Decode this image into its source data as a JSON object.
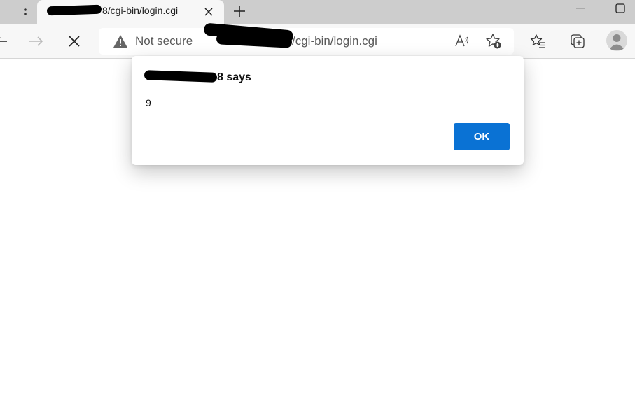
{
  "tab": {
    "title_suffix": "8/cgi-bin/login.cgi",
    "close_symbol": "✕",
    "new_tab_symbol": "+"
  },
  "window_controls": [
    "minimize",
    "maximize"
  ],
  "address_bar": {
    "security_label": "Not secure",
    "url_suffix": "/cgi-bin/login.cgi"
  },
  "toolbar_icons": [
    "back-icon",
    "forward-icon",
    "stop-icon",
    "read-aloud-icon",
    "add-favorite-icon",
    "favorites-icon",
    "collections-icon",
    "profile-icon"
  ],
  "dialog": {
    "title_suffix": "8 says",
    "message": "9",
    "ok_label": "OK",
    "ok_color": "#0a72d4"
  }
}
